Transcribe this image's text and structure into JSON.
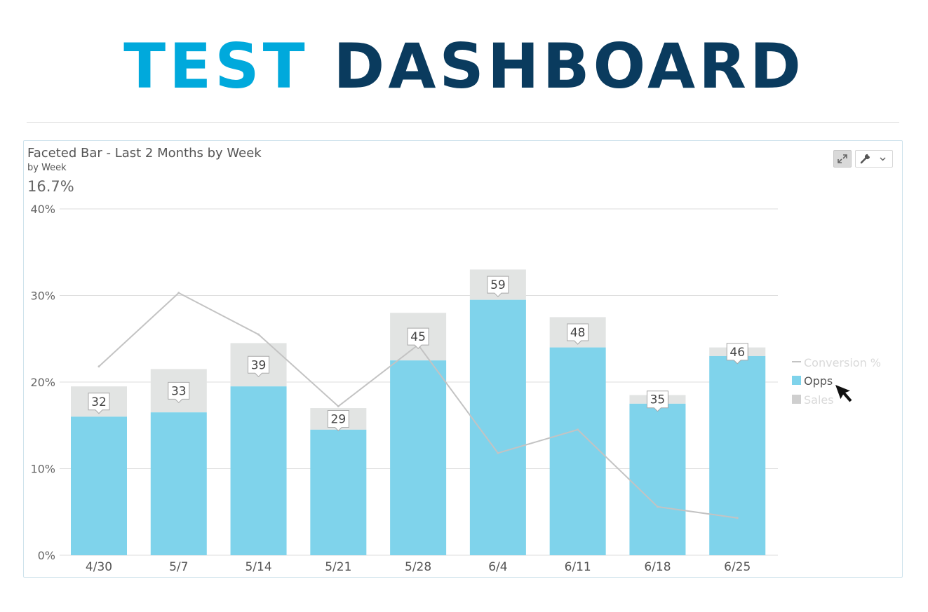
{
  "logo": {
    "word1": "TEST",
    "word2": "DASHBOARD"
  },
  "panel": {
    "title": "Faceted Bar - Last 2 Months by Week",
    "subtitle": "by Week",
    "value": "16.7%",
    "expand_icon": "expand-icon",
    "tools_icon": "wrench-icon"
  },
  "colors": {
    "opps": "#7fd3eb",
    "sales": "#e2e4e3",
    "line": "#c3c3c3",
    "grid": "#dedede",
    "logo_light": "#00a9dc",
    "logo_dark": "#0a3b5e"
  },
  "chart_data": {
    "type": "bar",
    "categories": [
      "4/30",
      "5/7",
      "5/14",
      "5/21",
      "5/28",
      "6/4",
      "6/11",
      "6/18",
      "6/25"
    ],
    "series": [
      {
        "name": "Opps",
        "values": [
          16,
          16.5,
          19.5,
          14.5,
          22.5,
          29.5,
          24,
          17.5,
          23
        ]
      },
      {
        "name": "Sales",
        "values": [
          3.5,
          5,
          5,
          2.5,
          5.5,
          3.5,
          3.5,
          1,
          1
        ]
      },
      {
        "name": "Conversion %",
        "values": [
          21.8,
          30.3,
          25.5,
          17.2,
          24.3,
          11.8,
          14.5,
          5.6,
          4.3
        ]
      }
    ],
    "data_labels": [
      "32",
      "33",
      "39",
      "29",
      "45",
      "59",
      "48",
      "35",
      "46"
    ],
    "yticks": [
      "0%",
      "10%",
      "20%",
      "30%",
      "40%"
    ],
    "ylim": [
      0,
      40
    ],
    "legend": [
      "Conversion %",
      "Opps",
      "Sales"
    ],
    "legend_position": "right",
    "grid": true
  }
}
